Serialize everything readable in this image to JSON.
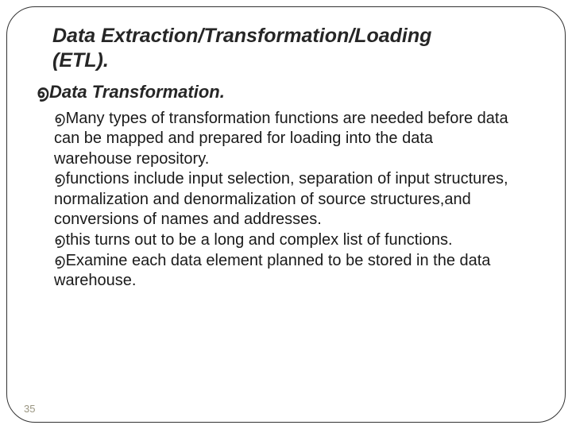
{
  "title_line1": "Data Extraction/Transformation/Loading",
  "title_line2": "(ETL).",
  "section_heading": "Data Transformation.",
  "bullets": {
    "b1": "Many types of transformation functions are needed before data",
    "b1c1": "can be mapped and prepared for loading into the data",
    "b1c2": "warehouse repository.",
    "b2": "functions include input selection, separation of input structures, normalization and denormalization of source structures,and conversions of names and addresses.",
    "b3": "this turns out to be a long and complex list of functions.",
    "b4": "Examine each data element planned to be stored in the data warehouse."
  },
  "bullet_glyph": "൭",
  "page_number": "35"
}
